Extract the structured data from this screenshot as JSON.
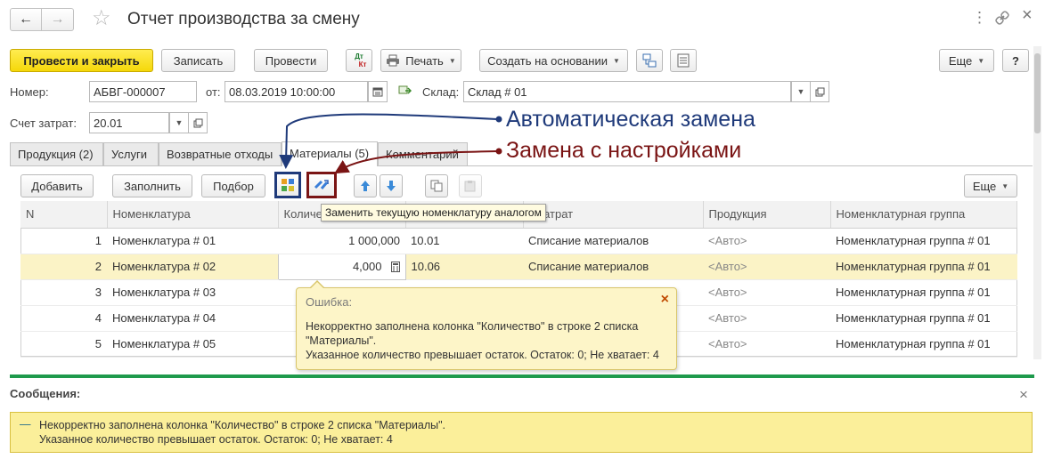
{
  "window": {
    "title": "Отчет производства за смену",
    "back_glyph": "←",
    "forward_glyph": "→",
    "star_glyph": "☆",
    "more_dots": "⋮",
    "link_glyph": "🔗",
    "close_glyph": "×"
  },
  "toolbar": {
    "post_close": "Провести и закрыть",
    "save": "Записать",
    "post": "Провести",
    "dtkt_top": "Дт",
    "dtkt_bottom": "Кт",
    "print": "Печать",
    "create_based": "Создать на основании",
    "more": "Еще",
    "help": "?"
  },
  "header": {
    "number_label": "Номер:",
    "number_value": "АБВГ-000007",
    "date_label": "от:",
    "date_value": "08.03.2019 10:00:00",
    "warehouse_label": "Склад:",
    "warehouse_value": "Склад # 01",
    "account_label": "Счет затрат:",
    "account_value": "20.01"
  },
  "tabs": [
    {
      "label": "Продукция (2)"
    },
    {
      "label": "Услуги"
    },
    {
      "label": "Возвратные отходы"
    },
    {
      "label": "Материалы (5)"
    },
    {
      "label": "Комментарий"
    }
  ],
  "table_toolbar": {
    "add": "Добавить",
    "fill": "Заполнить",
    "pick": "Подбор",
    "more": "Еще"
  },
  "tooltip": "Заменить текущую номенклатуру аналогом",
  "annotations": {
    "auto_replace": "Автоматическая замена",
    "replace_settings": "Замена с настройками",
    "auto_color": "#1f3a7a",
    "settings_color": "#7a1414"
  },
  "table": {
    "columns": [
      "N",
      "Номенклатура",
      "Количе",
      "я затрат",
      "Продукция",
      "Номенклатурная группа"
    ],
    "rows": [
      {
        "n": "1",
        "item": "Номенклатура # 01",
        "qty": "1 000,000",
        "account": "10.01",
        "cost": "Списание материалов",
        "product": "<Авто>",
        "group": "Номенклатурная группа # 01"
      },
      {
        "n": "2",
        "item": "Номенклатура # 02",
        "qty": "4,000",
        "account": "10.06",
        "cost": "Списание материалов",
        "product": "<Авто>",
        "group": "Номенклатурная группа # 01"
      },
      {
        "n": "3",
        "item": "Номенклатура # 03",
        "qty": "",
        "account": "",
        "cost": "",
        "product": "<Авто>",
        "group": "Номенклатурная группа # 01"
      },
      {
        "n": "4",
        "item": "Номенклатура # 04",
        "qty": "",
        "account": "",
        "cost": "",
        "product": "<Авто>",
        "group": "Номенклатурная группа # 01"
      },
      {
        "n": "5",
        "item": "Номенклатура # 05",
        "qty": "",
        "account": "",
        "cost": "",
        "product": "<Авто>",
        "group": "Номенклатурная группа # 01"
      }
    ]
  },
  "error_popup": {
    "title": "Ошибка:",
    "line1": "Некорректно заполнена колонка \"Количество\" в строке 2 списка",
    "line2": "\"Материалы\".",
    "line3": "Указанное количество превышает остаток. Остаток: 0; Не хватает: 4",
    "close": "×"
  },
  "messages": {
    "title": "Сообщения:",
    "close": "×",
    "bullet": "—",
    "line1": "Некорректно заполнена колонка \"Количество\" в строке 2 списка \"Материалы\".",
    "line2": "Указанное количество превышает остаток. Остаток: 0; Не хватает: 4"
  },
  "colors": {
    "primary_button": "#f5d80a",
    "selected_row": "#fbf3c6",
    "popup_bg": "#fdf5c8",
    "messages_bg": "#fbef9a",
    "separator_green": "#1e9a4c"
  }
}
